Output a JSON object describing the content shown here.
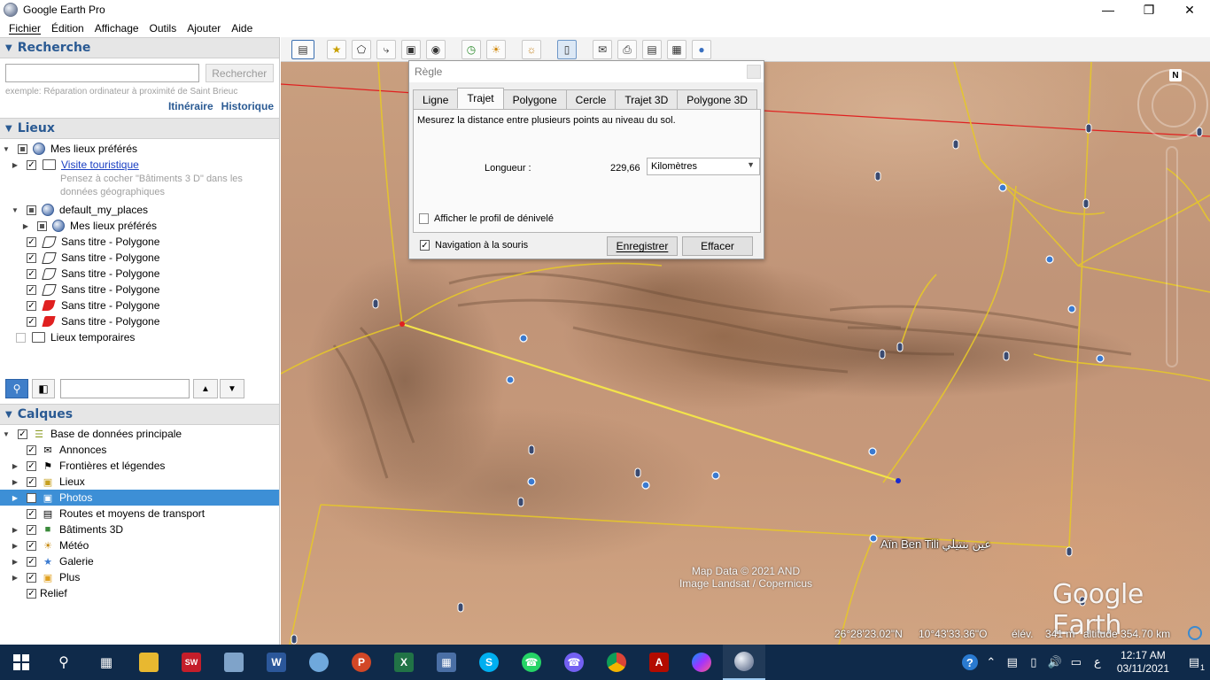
{
  "window": {
    "title": "Google Earth Pro"
  },
  "menu": [
    "Fichier",
    "Édition",
    "Affichage",
    "Outils",
    "Ajouter",
    "Aide"
  ],
  "search": {
    "header": "Recherche",
    "placeholder": "",
    "button": "Rechercher",
    "hint": "exemple: Réparation ordinateur à proximité de Saint Brieuc",
    "links": [
      "Itinéraire",
      "Historique"
    ]
  },
  "places": {
    "header": "Lieux",
    "items": [
      {
        "label": "Mes lieux préférés"
      },
      {
        "label": "Visite touristique"
      },
      {
        "label": "Pensez à cocher \"Bâtiments 3 D\" dans les"
      },
      {
        "label": "données géographiques"
      },
      {
        "label": "default_my_places"
      },
      {
        "label": "Mes lieux préférés"
      },
      {
        "label": "Sans titre - Polygone"
      },
      {
        "label": "Sans titre - Polygone"
      },
      {
        "label": "Sans titre - Polygone"
      },
      {
        "label": "Sans titre - Polygone"
      },
      {
        "label": "Sans titre - Polygone"
      },
      {
        "label": "Sans titre - Polygone"
      },
      {
        "label": "Lieux temporaires"
      }
    ]
  },
  "layers": {
    "header": "Calques",
    "items": [
      {
        "label": "Base de données principale"
      },
      {
        "label": "Annonces"
      },
      {
        "label": "Frontières et légendes"
      },
      {
        "label": "Lieux"
      },
      {
        "label": "Photos"
      },
      {
        "label": "Routes et moyens de transport"
      },
      {
        "label": "Bâtiments 3D"
      },
      {
        "label": "Météo"
      },
      {
        "label": "Galerie"
      },
      {
        "label": "Plus"
      },
      {
        "label": "Relief"
      }
    ]
  },
  "ruler": {
    "title": "Règle",
    "tabs": [
      "Ligne",
      "Trajet",
      "Polygone",
      "Cercle",
      "Trajet 3D",
      "Polygone 3D"
    ],
    "active_tab": "Trajet",
    "description": "Mesurez la distance entre plusieurs points au niveau du sol.",
    "length_label": "Longueur :",
    "length_value": "229,66",
    "unit": "Kilomètres",
    "elevation_profile": "Afficher le profil de dénivelé",
    "mouse_nav": "Navigation à la souris",
    "save_button": "Enregistrer",
    "clear_button": "Effacer"
  },
  "map": {
    "attribution_1": "Map Data © 2021 AND",
    "attribution_2": "Image Landsat / Copernicus",
    "logo": "Google Earth",
    "place_label": "Aïn Ben Tili عين بنتيلي",
    "compass_north": "N",
    "status": {
      "lat": "26°28'23.02\"N",
      "lon": "10°43'33.36\"O",
      "elev_label": "élév.",
      "elev_value": "341 m",
      "altitude": "altitude 354.70 km"
    },
    "path_color": "#f0e040",
    "border_color": "#e02020"
  },
  "taskbar": {
    "time": "12:17 AM",
    "date": "03/11/2021",
    "lang": "ع",
    "notification_count": "1"
  }
}
